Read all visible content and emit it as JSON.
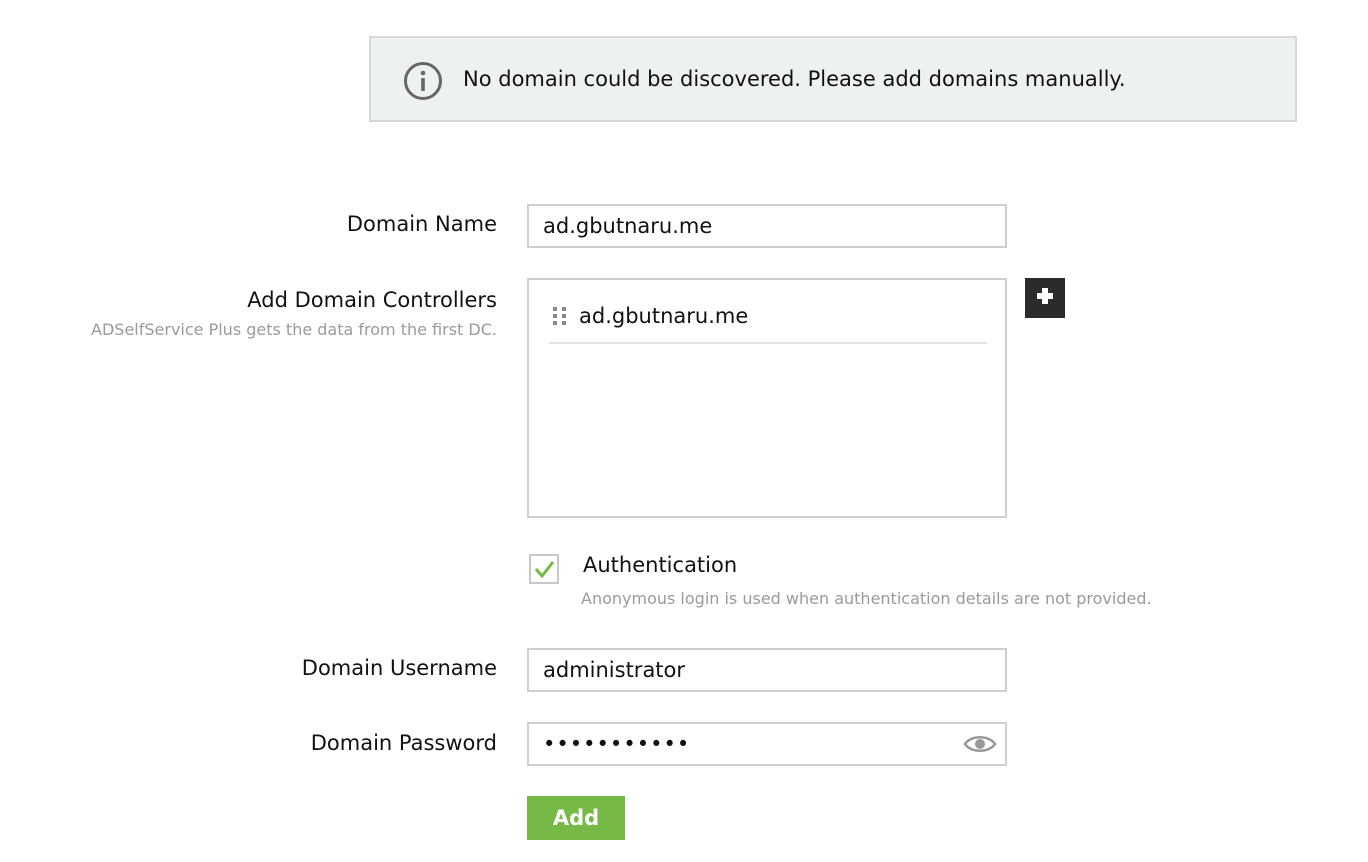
{
  "banner": {
    "icon": "info-icon",
    "message": "No domain could be discovered. Please add domains manually."
  },
  "form": {
    "domain_name": {
      "label": "Domain Name",
      "value": "ad.gbutnaru.me"
    },
    "domain_controllers": {
      "label": "Add Domain Controllers",
      "hint": "ADSelfService Plus gets the data from the first DC.",
      "items": [
        "ad.gbutnaru.me"
      ],
      "add_icon": "plus-icon"
    },
    "authentication": {
      "label": "Authentication",
      "checked": true,
      "hint": "Anonymous login is used when authentication details are not provided."
    },
    "domain_username": {
      "label": "Domain Username",
      "value": "administrator"
    },
    "domain_password": {
      "label": "Domain Password",
      "value": "•••••••••••",
      "toggle_icon": "eye-icon"
    },
    "submit_label": "Add"
  },
  "colors": {
    "accent_green": "#76b946",
    "banner_bg": "#eef1f2",
    "dark_button": "#2b2b2b"
  }
}
